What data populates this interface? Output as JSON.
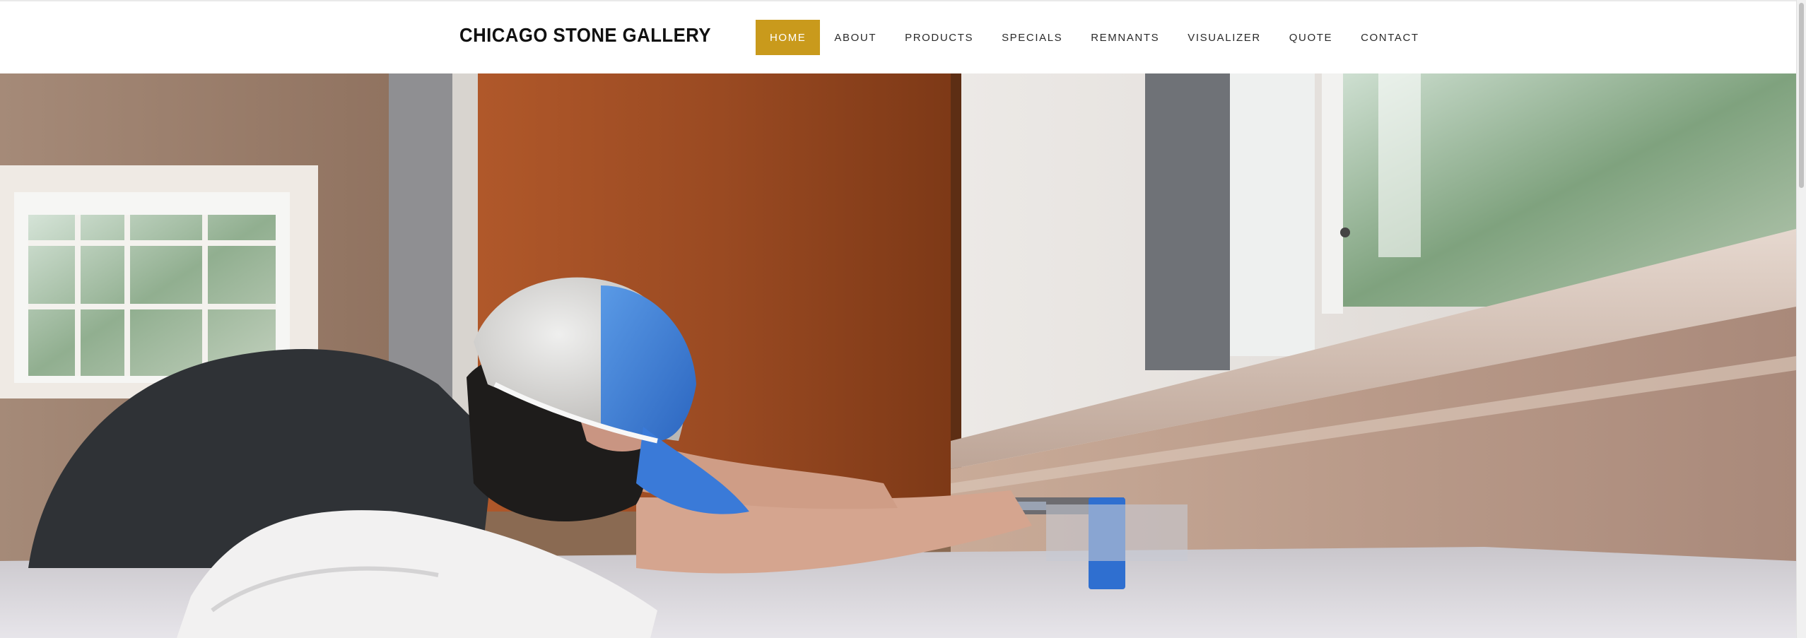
{
  "header": {
    "brand": "CHICAGO STONE GALLERY",
    "accent_color": "#c99a1c"
  },
  "nav": {
    "items": [
      {
        "label": "HOME",
        "active": true
      },
      {
        "label": "ABOUT",
        "active": false
      },
      {
        "label": "PRODUCTS",
        "active": false
      },
      {
        "label": "SPECIALS",
        "active": false
      },
      {
        "label": "REMNANTS",
        "active": false
      },
      {
        "label": "VISUALIZER",
        "active": false
      },
      {
        "label": "QUOTE",
        "active": false
      },
      {
        "label": "CONTACT",
        "active": false
      }
    ]
  },
  "hero": {
    "media": "video-frame",
    "subject": "installer leveling a countertop"
  },
  "scroll": {
    "position": 0
  }
}
